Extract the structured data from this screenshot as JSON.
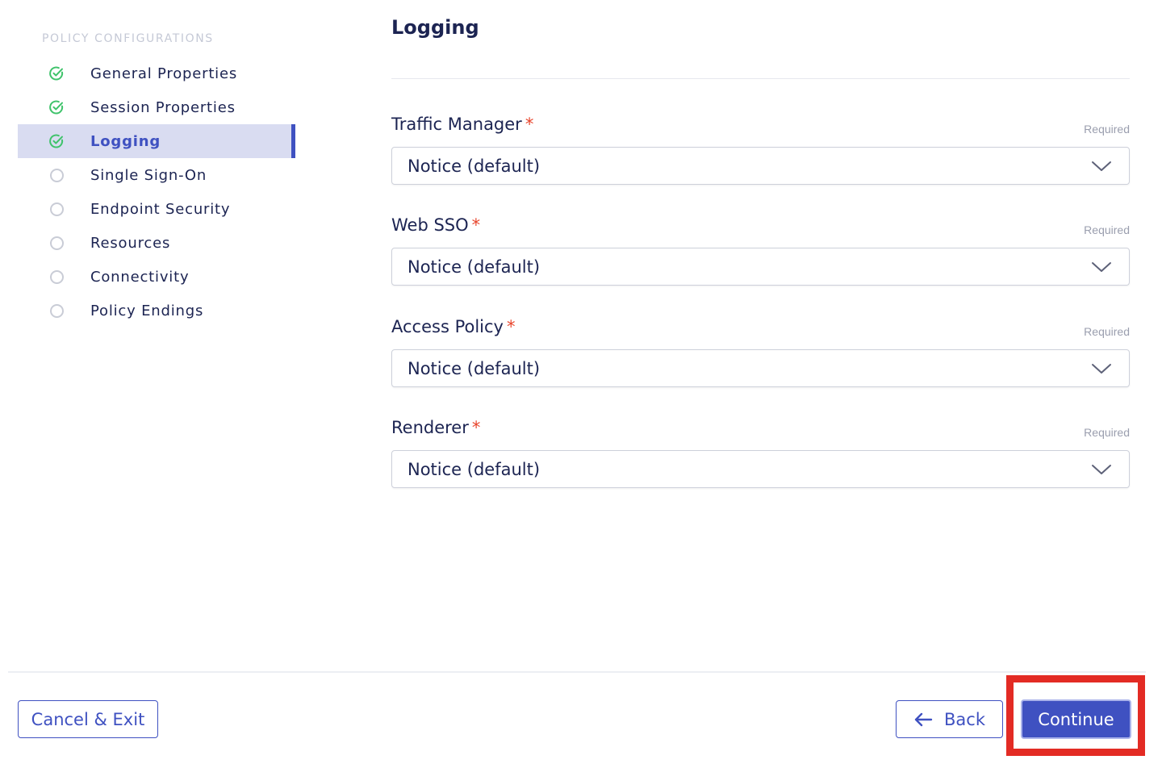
{
  "sidebar": {
    "heading": "POLICY CONFIGURATIONS",
    "steps": [
      {
        "label": "General Properties",
        "status": "complete"
      },
      {
        "label": "Session Properties",
        "status": "complete"
      },
      {
        "label": "Logging",
        "status": "current"
      },
      {
        "label": "Single Sign-On",
        "status": "pending"
      },
      {
        "label": "Endpoint Security",
        "status": "pending"
      },
      {
        "label": "Resources",
        "status": "pending"
      },
      {
        "label": "Connectivity",
        "status": "pending"
      },
      {
        "label": "Policy Endings",
        "status": "pending"
      }
    ]
  },
  "main": {
    "title": "Logging",
    "fields": [
      {
        "label": "Traffic Manager",
        "required_marker": "*",
        "required_text": "Required",
        "value": "Notice (default)"
      },
      {
        "label": "Web SSO",
        "required_marker": "*",
        "required_text": "Required",
        "value": "Notice (default)"
      },
      {
        "label": "Access Policy",
        "required_marker": "*",
        "required_text": "Required",
        "value": "Notice (default)"
      },
      {
        "label": "Renderer",
        "required_marker": "*",
        "required_text": "Required",
        "value": "Notice (default)"
      }
    ]
  },
  "footer": {
    "cancel_label": "Cancel & Exit",
    "back_label": "Back",
    "continue_label": "Continue"
  },
  "colors": {
    "accent": "#3f51c1",
    "complete_check": "#3fc36b",
    "required_star": "#e8452c",
    "highlight": "#e32b24"
  }
}
